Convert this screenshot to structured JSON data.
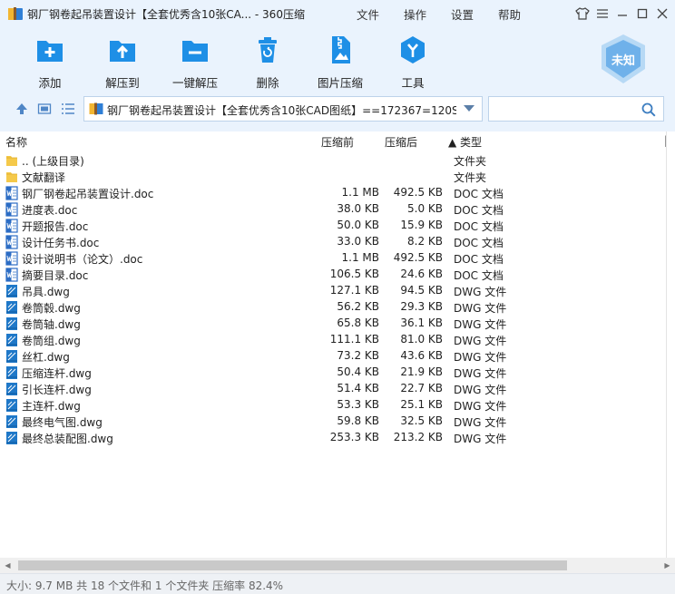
{
  "window": {
    "title": "钢厂钢卷起吊装置设计【全套优秀含10张CA... - 360压缩",
    "menu": [
      "文件",
      "操作",
      "设置",
      "帮助"
    ]
  },
  "toolbar": [
    {
      "label": "添加",
      "icon": "add-icon"
    },
    {
      "label": "解压到",
      "icon": "extract-to-icon"
    },
    {
      "label": "一键解压",
      "icon": "one-click-extract-icon"
    },
    {
      "label": "删除",
      "icon": "trash-icon"
    },
    {
      "label": "图片压缩",
      "icon": "image-compress-icon"
    },
    {
      "label": "工具",
      "icon": "tools-icon"
    }
  ],
  "badge": {
    "label": "未知"
  },
  "address": {
    "path": "钢厂钢卷起吊装置设计【全套优秀含10张CAD图纸】==172367=120S5...",
    "search_placeholder": ""
  },
  "columns": {
    "name": "名称",
    "original": "压缩前",
    "compressed": "压缩后",
    "type": "▲ 类型"
  },
  "files": [
    {
      "name": ".. (上级目录)",
      "original": "",
      "compressed": "",
      "type": "文件夹",
      "kind": "folder"
    },
    {
      "name": "文献翻译",
      "original": "",
      "compressed": "",
      "type": "文件夹",
      "kind": "folder"
    },
    {
      "name": "钢厂钢卷起吊装置设计.doc",
      "original": "1.1 MB",
      "compressed": "492.5 KB",
      "type": "DOC 文档",
      "kind": "doc"
    },
    {
      "name": "进度表.doc",
      "original": "38.0 KB",
      "compressed": "5.0 KB",
      "type": "DOC 文档",
      "kind": "doc"
    },
    {
      "name": "开题报告.doc",
      "original": "50.0 KB",
      "compressed": "15.9 KB",
      "type": "DOC 文档",
      "kind": "doc"
    },
    {
      "name": "设计任务书.doc",
      "original": "33.0 KB",
      "compressed": "8.2 KB",
      "type": "DOC 文档",
      "kind": "doc"
    },
    {
      "name": "设计说明书（论文）.doc",
      "original": "1.1 MB",
      "compressed": "492.5 KB",
      "type": "DOC 文档",
      "kind": "doc"
    },
    {
      "name": "摘要目录.doc",
      "original": "106.5 KB",
      "compressed": "24.6 KB",
      "type": "DOC 文档",
      "kind": "doc"
    },
    {
      "name": "吊具.dwg",
      "original": "127.1 KB",
      "compressed": "94.5 KB",
      "type": "DWG 文件",
      "kind": "dwg"
    },
    {
      "name": "卷筒毂.dwg",
      "original": "56.2 KB",
      "compressed": "29.3 KB",
      "type": "DWG 文件",
      "kind": "dwg"
    },
    {
      "name": "卷筒轴.dwg",
      "original": "65.8 KB",
      "compressed": "36.1 KB",
      "type": "DWG 文件",
      "kind": "dwg"
    },
    {
      "name": "卷筒组.dwg",
      "original": "111.1 KB",
      "compressed": "81.0 KB",
      "type": "DWG 文件",
      "kind": "dwg"
    },
    {
      "name": "丝杠.dwg",
      "original": "73.2 KB",
      "compressed": "43.6 KB",
      "type": "DWG 文件",
      "kind": "dwg"
    },
    {
      "name": "压缩连杆.dwg",
      "original": "50.4 KB",
      "compressed": "21.9 KB",
      "type": "DWG 文件",
      "kind": "dwg"
    },
    {
      "name": "引长连杆.dwg",
      "original": "51.4 KB",
      "compressed": "22.7 KB",
      "type": "DWG 文件",
      "kind": "dwg"
    },
    {
      "name": "主连杆.dwg",
      "original": "53.3 KB",
      "compressed": "25.1 KB",
      "type": "DWG 文件",
      "kind": "dwg"
    },
    {
      "name": "最终电气图.dwg",
      "original": "59.8 KB",
      "compressed": "32.5 KB",
      "type": "DWG 文件",
      "kind": "dwg"
    },
    {
      "name": "最终总装配图.dwg",
      "original": "253.3 KB",
      "compressed": "213.2 KB",
      "type": "DWG 文件",
      "kind": "dwg"
    }
  ],
  "status": "大小: 9.7 MB 共 18 个文件和 1 个文件夹 压缩率 82.4%",
  "colors": {
    "accent": "#1e8fe6",
    "header_bg": "#eaf3fd",
    "folder": "#f5c94a",
    "doc_icon": "#2b6cc4",
    "dwg_icon": "#1f78c8"
  }
}
